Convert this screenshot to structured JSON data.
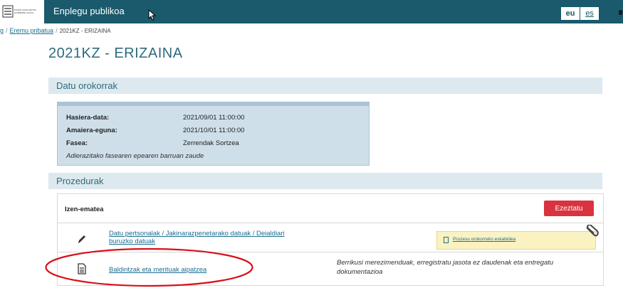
{
  "header": {
    "logo_text": "EUSKO JAURLARITZA GOBIERNO VASCO",
    "title": "Enplegu publikoa",
    "languages": [
      "eu",
      "es"
    ]
  },
  "breadcrumb": {
    "first": "g",
    "second": "Eremu pribatua",
    "current": "2021KZ - ERIZAINA"
  },
  "page_title": "2021KZ - ERIZAINA",
  "datu_orokorrak": {
    "heading": "Datu orokorrak",
    "rows": [
      {
        "label": "Hasiera-data:",
        "value": "2021/09/01 11:00:00"
      },
      {
        "label": "Amaiera-eguna:",
        "value": "2021/10/01 11:00:00"
      },
      {
        "label": "Fasea:",
        "value": "Zerrendak Sortzea"
      }
    ],
    "note": "Adierazitako fasearen epearen barruan zaude"
  },
  "prozedurak": {
    "heading": "Prozedurak",
    "group_label": "Izen-ematea",
    "cancel_label": "Ezeztatu",
    "rows": [
      {
        "icon": "pencil-icon",
        "link_line1": "Datu pertsonalak / Jakinarazpenetarako datuak / Deialdiari",
        "link_line2": "buruzko datuak",
        "note_link": "Prozesu orokorreko eskabidea"
      },
      {
        "icon": "document-icon",
        "link": "Baldintzak eta merituak aipatzea",
        "note_line1": "Berrikusi merezimenduak, erregistratu jasota ez daudenak eta entregatu",
        "note_line2": "dokumentazioa"
      }
    ]
  },
  "colors": {
    "topbar": "#1a5a6c",
    "accent_text": "#2e6a7e",
    "link": "#1a6e92",
    "cancel_button": "#d9333f",
    "info_box": "#cfdfea",
    "note_yellow": "#fbf2c2",
    "highlight_ellipse": "#d8101a"
  }
}
